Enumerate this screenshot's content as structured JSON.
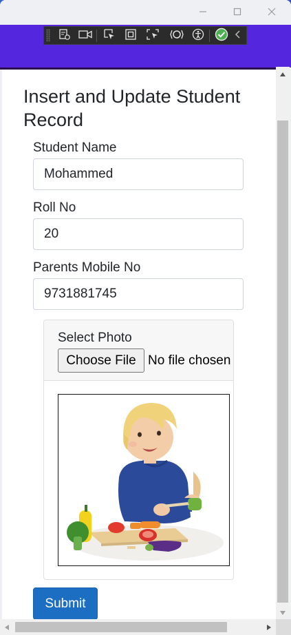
{
  "page": {
    "title": "Insert and Update Student Record"
  },
  "form": {
    "student_name_label": "Student Name",
    "student_name_value": "Mohammed",
    "roll_no_label": "Roll No",
    "roll_no_value": "20",
    "parents_mobile_label": "Parents Mobile No",
    "parents_mobile_value": "9731881745",
    "photo_label": "Select Photo",
    "choose_file_label": "Choose File",
    "file_status": "No file chosen",
    "submit_label": "Submit"
  },
  "window_controls": [
    "minimize-icon",
    "maximize-icon",
    "close-icon"
  ],
  "dev_toolbar_icons": [
    "live-visual-tree-icon",
    "camera-icon",
    "select-element-icon",
    "display-layout-adorners-icon",
    "track-focus-icon",
    "binding-failures-icon",
    "accessibility-icon",
    "check-circle-icon",
    "collapse-chevron-icon"
  ],
  "colors": {
    "accent": "#5427df",
    "submit": "#1b6ec2",
    "devtools_check": "#4caf50"
  }
}
